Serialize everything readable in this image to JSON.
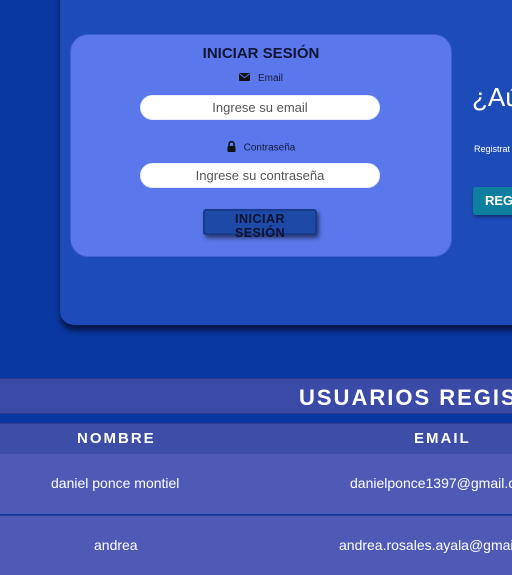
{
  "login": {
    "title": "INICIAR SESIÓN",
    "email_label": "Email",
    "email_icon": "envelope-icon",
    "email_placeholder": "Ingrese su email",
    "password_label": "Contraseña",
    "password_icon": "lock-icon",
    "password_placeholder": "Ingrese su contraseña",
    "submit_label": "INICIAR SESIÓN"
  },
  "register_panel": {
    "heading": "¿Aú",
    "text": "Registrat",
    "button_label": "REG"
  },
  "users": {
    "title": "USUARIOS REGIS",
    "columns": [
      "NOMBRE",
      "EMAIL"
    ],
    "rows": [
      {
        "nombre": "daniel ponce montiel",
        "email": "danielponce1397@gmail.c"
      },
      {
        "nombre": "andrea",
        "email": "andrea.rosales.ayala@gmai"
      }
    ]
  }
}
